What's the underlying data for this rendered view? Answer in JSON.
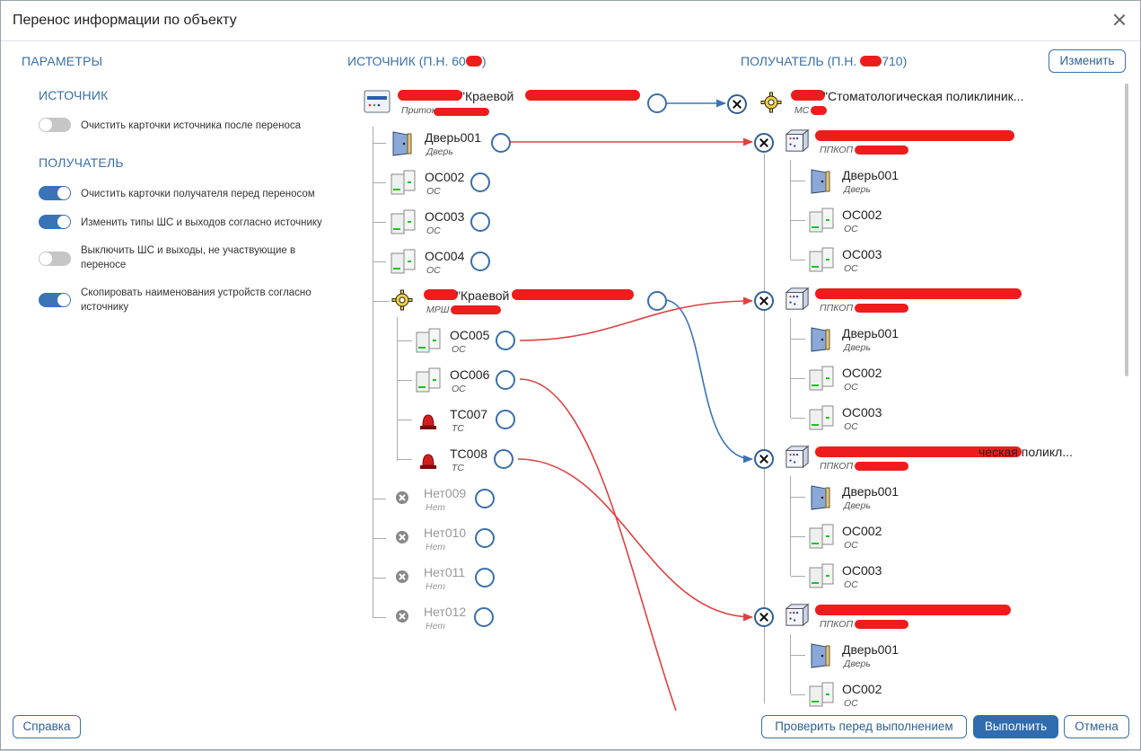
{
  "title": "Перенос информации по объекту",
  "params": {
    "header": "ПАРАМЕТРЫ",
    "source_header": "ИСТОЧНИК",
    "recipient_header": "ПОЛУЧАТЕЛЬ",
    "source_options": [
      {
        "label": "Очистить карточки источника после переноса",
        "on": false
      }
    ],
    "recipient_options": [
      {
        "label": "Очистить карточки получателя перед переносом",
        "on": true
      },
      {
        "label": "Изменить типы ШС и выходов согласно источнику",
        "on": true
      },
      {
        "label": "Выключить ШС и выходы, не участвующие в переносе",
        "on": false
      },
      {
        "label": "Скопировать наименования устройств согласно источнику",
        "on": true
      }
    ]
  },
  "source": {
    "header": "ИСТОЧНИК (П.Н. 60",
    "header_end": ")",
    "root": {
      "name": "\"Краевой",
      "type": "Приток"
    },
    "items": [
      {
        "name": "Дверь001",
        "type": "Дверь",
        "icon": "door-icon"
      },
      {
        "name": "ОС002",
        "type": "ОС",
        "icon": "sensor-icon"
      },
      {
        "name": "ОС003",
        "type": "ОС",
        "icon": "sensor-icon"
      },
      {
        "name": "ОС004",
        "type": "ОС",
        "icon": "sensor-icon"
      }
    ],
    "sub": {
      "name": "\"Краевой",
      "type": "МРШ"
    },
    "sub_items": [
      {
        "name": "ОС005",
        "type": "ОС",
        "icon": "sensor-icon"
      },
      {
        "name": "ОС006",
        "type": "ОС",
        "icon": "sensor-icon"
      },
      {
        "name": "ТС007",
        "type": "ТС",
        "icon": "siren-icon"
      },
      {
        "name": "ТС008",
        "type": "ТС",
        "icon": "siren-icon"
      }
    ],
    "disabled_items": [
      {
        "name": "Нет009",
        "type": "Нет"
      },
      {
        "name": "Нет010",
        "type": "Нет"
      },
      {
        "name": "Нет011",
        "type": "Нет"
      },
      {
        "name": "Нет012",
        "type": "Нет"
      }
    ]
  },
  "recipient": {
    "header": "ПОЛУЧАТЕЛЬ (П.Н.",
    "header_end": "710)",
    "change_button": "Изменить",
    "root": {
      "name": "\"Стоматологическая поликлиник...",
      "type": "МС"
    },
    "groups": [
      {
        "name": "",
        "type": "ППКОП",
        "items": [
          {
            "name": "Дверь001",
            "type": "Дверь"
          },
          {
            "name": "ОС002",
            "type": "ОС"
          },
          {
            "name": "ОС003",
            "type": "ОС"
          }
        ]
      },
      {
        "name": "",
        "type": "ППКОП",
        "items": [
          {
            "name": "Дверь001",
            "type": "Дверь"
          },
          {
            "name": "ОС002",
            "type": "ОС"
          },
          {
            "name": "ОС003",
            "type": "ОС"
          }
        ]
      },
      {
        "name": "ческая поликл...",
        "type": "ППКОП",
        "items": [
          {
            "name": "Дверь001",
            "type": "Дверь"
          },
          {
            "name": "ОС002",
            "type": "ОС"
          },
          {
            "name": "ОС003",
            "type": "ОС"
          }
        ]
      },
      {
        "name": "",
        "type": "ППКОП",
        "items": [
          {
            "name": "Дверь001",
            "type": "Дверь"
          },
          {
            "name": "ОС002",
            "type": "ОС"
          }
        ]
      }
    ]
  },
  "footer": {
    "help": "Справка",
    "check": "Проверить перед выполнением",
    "execute": "Выполнить",
    "cancel": "Отмена"
  },
  "colors": {
    "accent": "#2f6cb0",
    "link_blue": "#3a73b8",
    "link_red": "#e04040",
    "redaction": "#ee1c1c"
  }
}
